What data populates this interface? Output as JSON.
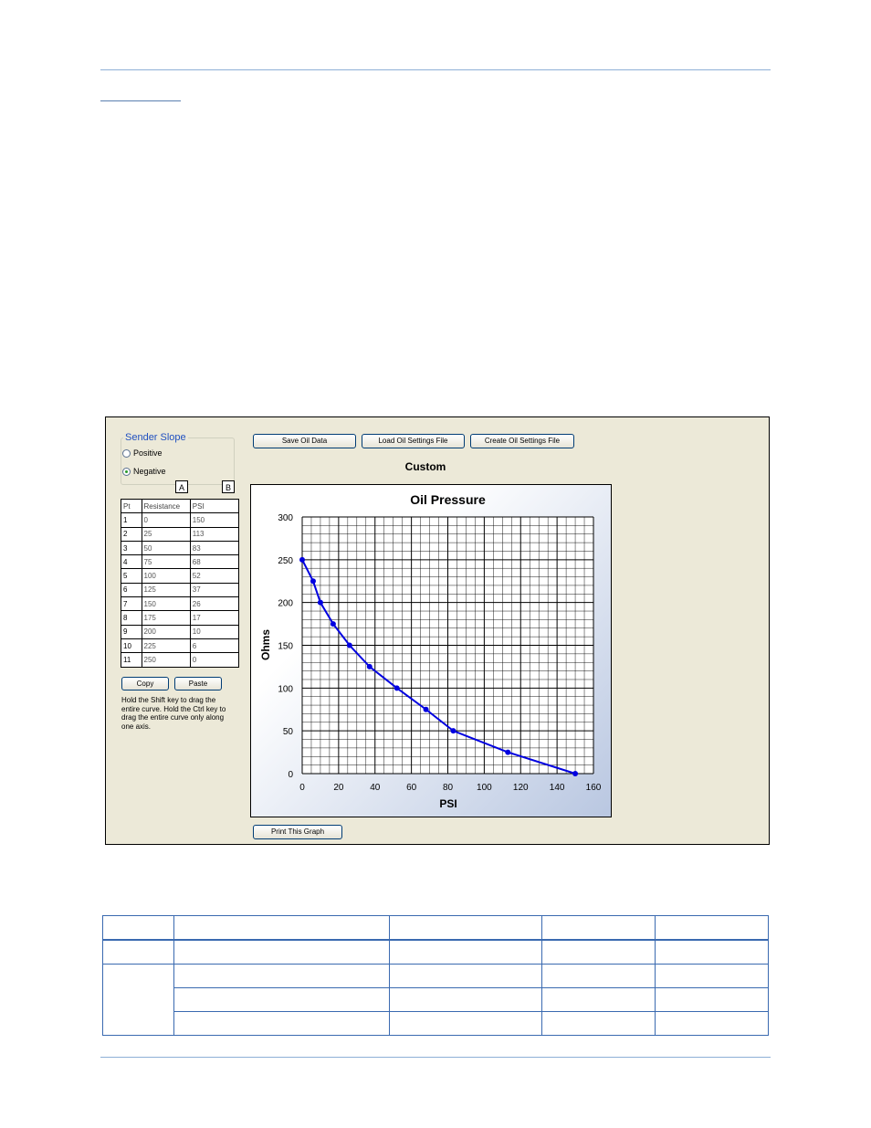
{
  "sender_slope": {
    "title": "Sender Slope",
    "options": [
      {
        "label": "Positive",
        "selected": false
      },
      {
        "label": "Negative",
        "selected": true
      }
    ]
  },
  "column_markers": [
    "A",
    "B"
  ],
  "points_table": {
    "headers": [
      "Pt",
      "Resistance",
      "PSI"
    ],
    "rows": [
      [
        "1",
        "0",
        "150"
      ],
      [
        "2",
        "25",
        "113"
      ],
      [
        "3",
        "50",
        "83"
      ],
      [
        "4",
        "75",
        "68"
      ],
      [
        "5",
        "100",
        "52"
      ],
      [
        "6",
        "125",
        "37"
      ],
      [
        "7",
        "150",
        "26"
      ],
      [
        "8",
        "175",
        "17"
      ],
      [
        "9",
        "200",
        "10"
      ],
      [
        "10",
        "225",
        "6"
      ],
      [
        "11",
        "250",
        "0"
      ]
    ]
  },
  "buttons": {
    "copy": "Copy",
    "paste": "Paste",
    "save_oil_data": "Save Oil Data",
    "load_oil_settings": "Load Oil Settings File",
    "create_oil_settings": "Create Oil Settings File",
    "print_graph": "Print This Graph"
  },
  "hint_text": "Hold the Shift key to drag the entire curve.  Hold the Ctrl key to drag the entire curve only along one axis.",
  "custom_label": "Custom",
  "colors": {
    "curve": "#0000e0",
    "panel_bg": "#ece9d8",
    "accent_rule": "#8eb0d6"
  },
  "chart_data": {
    "type": "line",
    "title": "Oil Pressure",
    "xlabel": "PSI",
    "ylabel": "Ohms",
    "xlim": [
      0,
      160
    ],
    "ylim": [
      0,
      300
    ],
    "x_ticks": [
      0,
      20,
      40,
      60,
      80,
      100,
      120,
      140,
      160
    ],
    "y_ticks": [
      0,
      50,
      100,
      150,
      200,
      250,
      300
    ],
    "grid": true,
    "series": [
      {
        "x": [
          150,
          113,
          83,
          68,
          52,
          37,
          26,
          17,
          10,
          6,
          0
        ],
        "y": [
          0,
          25,
          50,
          75,
          100,
          125,
          150,
          175,
          200,
          225,
          250
        ]
      }
    ]
  }
}
